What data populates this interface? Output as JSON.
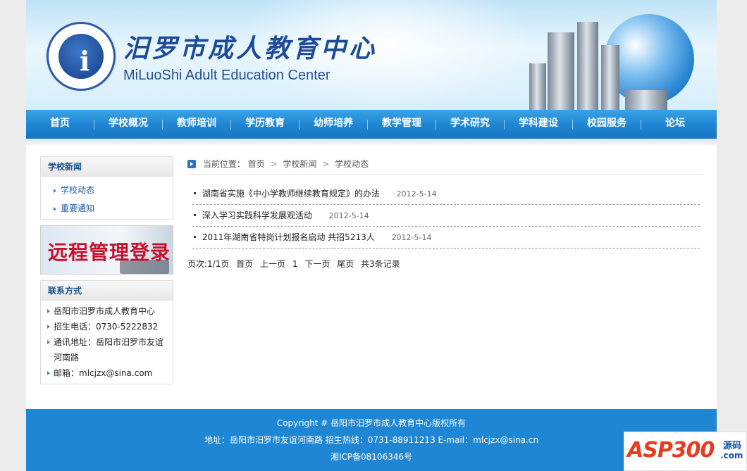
{
  "header": {
    "title_cn": "汨罗市成人教育中心",
    "title_en": "MiLuoShi Adult Education Center",
    "logo_glyph": "i"
  },
  "nav": {
    "items": [
      "首页",
      "学校概况",
      "教师培训",
      "学历教育",
      "幼师培养",
      "教学管理",
      "学术研究",
      "学科建设",
      "校园服务",
      "论坛"
    ]
  },
  "sidebar": {
    "news_title": "学校新闻",
    "news_links": [
      "学校动态",
      "重要通知"
    ],
    "login_banner": "远程管理登录",
    "contact_title": "联系方式",
    "contact_lines": [
      "岳阳市汨罗市成人教育中心",
      "招生电话：0730-5222832",
      "通讯地址：岳阳市汨罗市友谊河南路",
      "邮箱：mlcjzx@sina.com"
    ]
  },
  "breadcrumb": {
    "prefix": "当前位置：",
    "items": [
      "首页",
      "学校新闻",
      "学校动态"
    ],
    "separator": ">"
  },
  "news": [
    {
      "title": "湖南省实施《中小学教师继续教育规定》的办法",
      "date": "2012-5-14"
    },
    {
      "title": "深入学习实践科学发展观活动",
      "date": "2012-5-14"
    },
    {
      "title": "2011年湖南省特岗计划报名启动 共招5213人",
      "date": "2012-5-14"
    }
  ],
  "pager": {
    "info": "页次:1/1页",
    "first": "首页",
    "prev": "上一页",
    "current": "1",
    "next": "下一页",
    "last": "尾页",
    "total": "共3条记录"
  },
  "footer": {
    "copyright": "Copyright # 岳阳市汨罗市成人教育中心版权所有",
    "address": "地址：岳阳市汨罗市友谊河南路  招生热线：0731-88911213 E-mail：mlcjzx@sina.cn",
    "icp": "湘ICP备08106346号"
  },
  "watermark": {
    "brand": "ASP300",
    "suffix": "源码",
    "domain": ".com"
  },
  "colors": {
    "nav_blue": "#1e84d2",
    "footer_blue": "#1f86d4",
    "title_blue": "#1d4b97",
    "login_red": "#c8102e"
  }
}
